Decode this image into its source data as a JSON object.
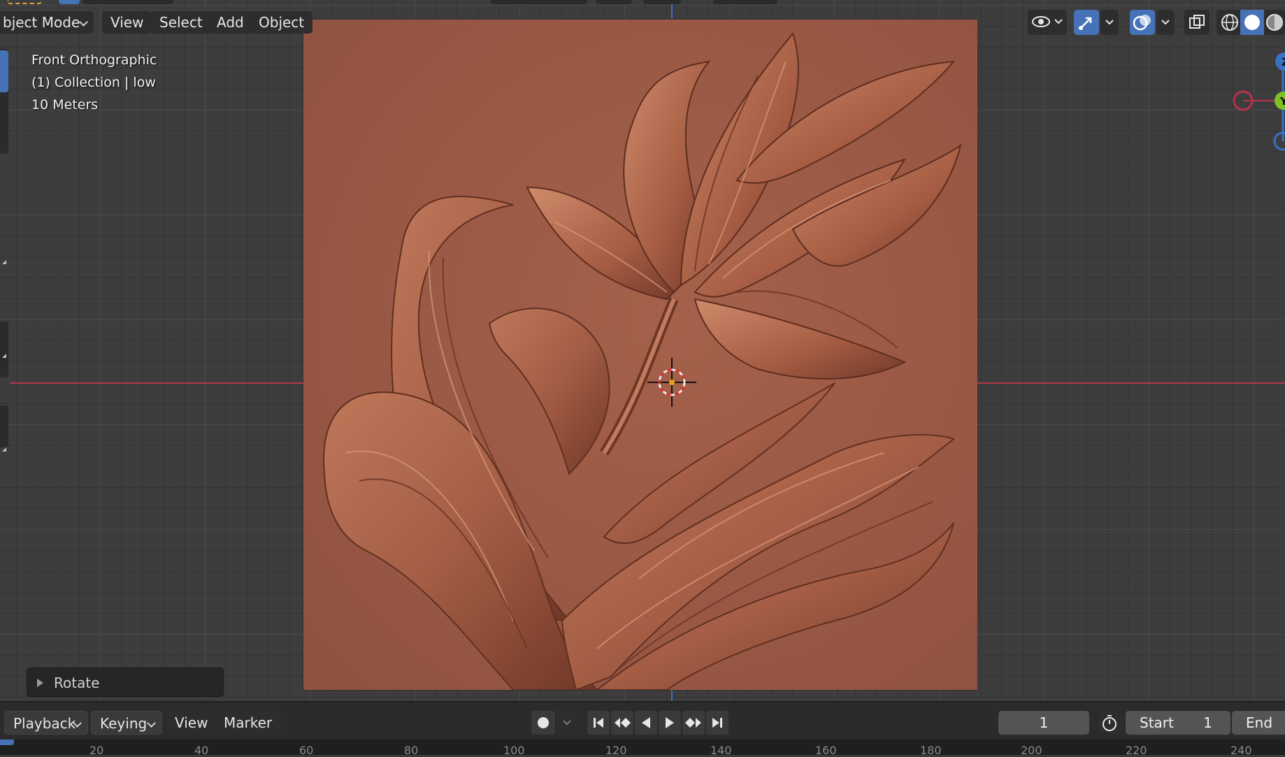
{
  "header": {
    "mode_label": "bject Mode",
    "menus": [
      "View",
      "Select",
      "Add",
      "Object"
    ]
  },
  "viewport": {
    "view_name": "Front Orthographic",
    "collection_info": "(1) Collection | low",
    "scale_info": "10 Meters",
    "panel_color": "#9b5a44"
  },
  "gizmo": {
    "z_label": "Z",
    "y_label": "Y",
    "x_color": "#b8324a",
    "y_color": "#7fbf26",
    "z_color": "#3a71c2"
  },
  "redo_panel": {
    "label": "Rotate"
  },
  "timeline": {
    "menus": [
      "Playback",
      "Keying",
      "View",
      "Marker"
    ],
    "current_frame": "1",
    "start_label": "Start",
    "start_value": "1",
    "end_label": "End",
    "ruler_marks": [
      "20",
      "40",
      "60",
      "80",
      "100",
      "120",
      "140",
      "160",
      "180",
      "200",
      "220",
      "240"
    ]
  },
  "icons": {
    "visibility": "eye-icon",
    "gizmo_toggle": "gizmo-icon",
    "overlay_toggle": "overlays-icon",
    "xray": "xray-icon",
    "wireframe": "wireframe-shading-icon",
    "solid": "solid-shading-icon",
    "material": "material-shading-icon"
  }
}
